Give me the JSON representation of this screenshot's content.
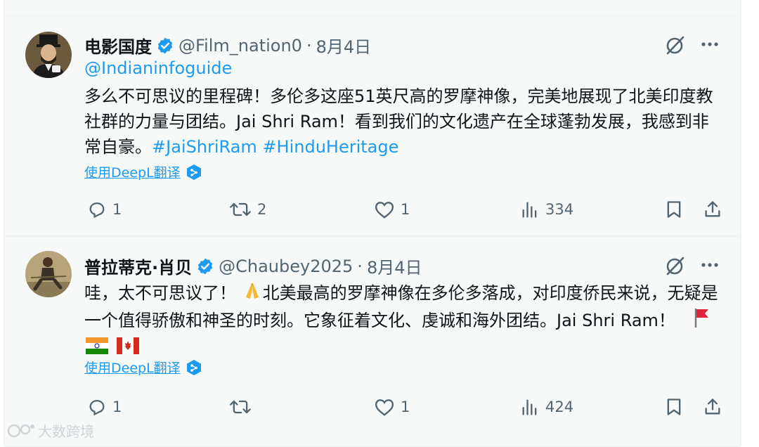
{
  "tweets": [
    {
      "name": "电影国度",
      "handle": "@Film_nation0",
      "separator": "·",
      "date": "8月4日",
      "mention": "@Indianinfoguide",
      "text": " 多么不可思议的里程碑！多伦多这座51英尺高的罗摩神像，完美地展现了北美印度教社群的力量与团结。Jai Shri Ram！看到我们的文化遗产在全球蓬勃发展，我感到非常自豪。",
      "hashtags": [
        "#JaiShriRam",
        "#HinduHeritage"
      ],
      "translate_label": "使用DeepL翻译",
      "replies": "1",
      "retweets": "2",
      "likes": "1",
      "views": "334"
    },
    {
      "name": "普拉蒂克·肖贝",
      "handle": "@Chaubey2025",
      "separator": "·",
      "date": "8月4日",
      "text_part1": "哇，太不可思议了！",
      "text_part2": "北美最高的罗摩神像在多伦多落成，对印度侨民来说，无疑是一个值得骄傲和神圣的时刻。它象征着文化、虔诚和海外团结。Jai Shri Ram！",
      "translate_label": "使用DeepL翻译",
      "replies": "1",
      "retweets": "",
      "likes": "1",
      "views": "424"
    }
  ],
  "watermark": "大数跨境",
  "colors": {
    "accent": "#1d9bf0",
    "muted": "#536471",
    "text": "#0f1419",
    "bg": "#f7f9f9"
  },
  "icons": [
    "verified-badge-icon",
    "grok-icon",
    "more-icon",
    "reply-icon",
    "retweet-icon",
    "like-icon",
    "views-icon",
    "bookmark-icon",
    "share-icon",
    "deepl-icon",
    "pray-emoji-icon",
    "flag-red-icon",
    "flag-india-icon",
    "flag-canada-icon"
  ]
}
